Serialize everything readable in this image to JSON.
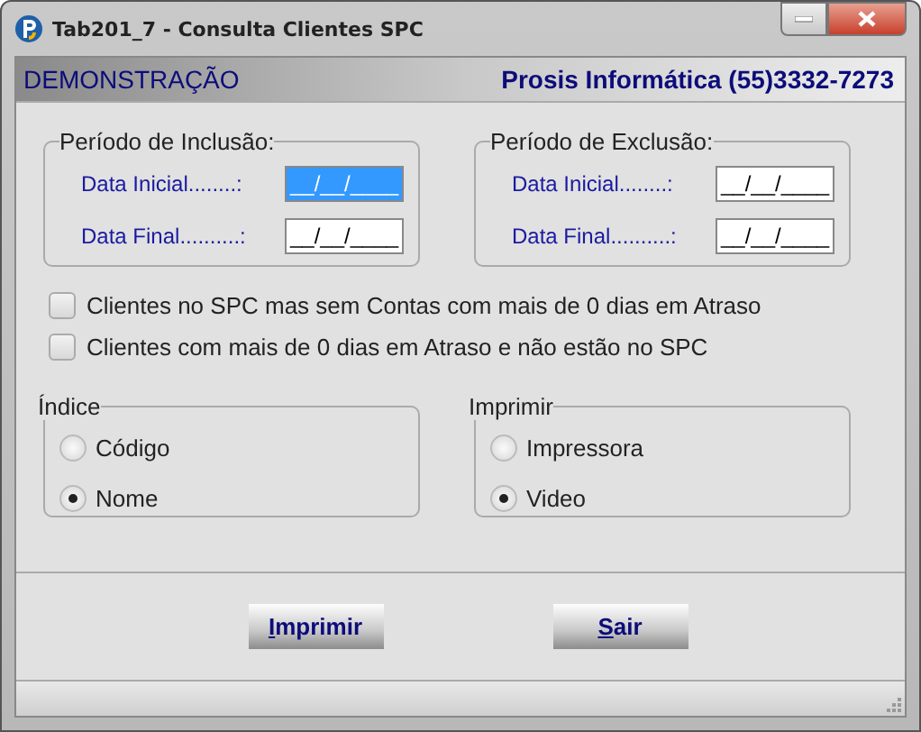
{
  "window": {
    "title": "Tab201_7 - Consulta Clientes SPC"
  },
  "header": {
    "left": "DEMONSTRAÇÃO",
    "right": "Prosis Informática (55)3332-7273"
  },
  "periods": [
    {
      "title": "Período de Inclusão:",
      "fields": [
        {
          "label": "Data Inicial........:",
          "value": "__/__/____",
          "selected": true
        },
        {
          "label": "Data Final..........:",
          "value": "__/__/____",
          "selected": false
        }
      ]
    },
    {
      "title": "Período de Exclusão:",
      "fields": [
        {
          "label": "Data Inicial........:",
          "value": "__/__/____",
          "selected": false
        },
        {
          "label": "Data Final..........:",
          "value": "__/__/____",
          "selected": false
        }
      ]
    }
  ],
  "checkboxes": [
    {
      "label": "Clientes no SPC mas sem Contas com mais de 0 dias em Atraso",
      "checked": false
    },
    {
      "label": "Clientes com mais de 0 dias em Atraso e não estão no SPC",
      "checked": false
    }
  ],
  "radio_groups": [
    {
      "title": "Índice",
      "options": [
        {
          "label": "Código",
          "selected": false
        },
        {
          "label": "Nome",
          "selected": true
        }
      ]
    },
    {
      "title": "Imprimir",
      "options": [
        {
          "label": "Impressora",
          "selected": false
        },
        {
          "label": "Video",
          "selected": true
        }
      ]
    }
  ],
  "buttons": [
    "Imprimir",
    "Sair"
  ]
}
